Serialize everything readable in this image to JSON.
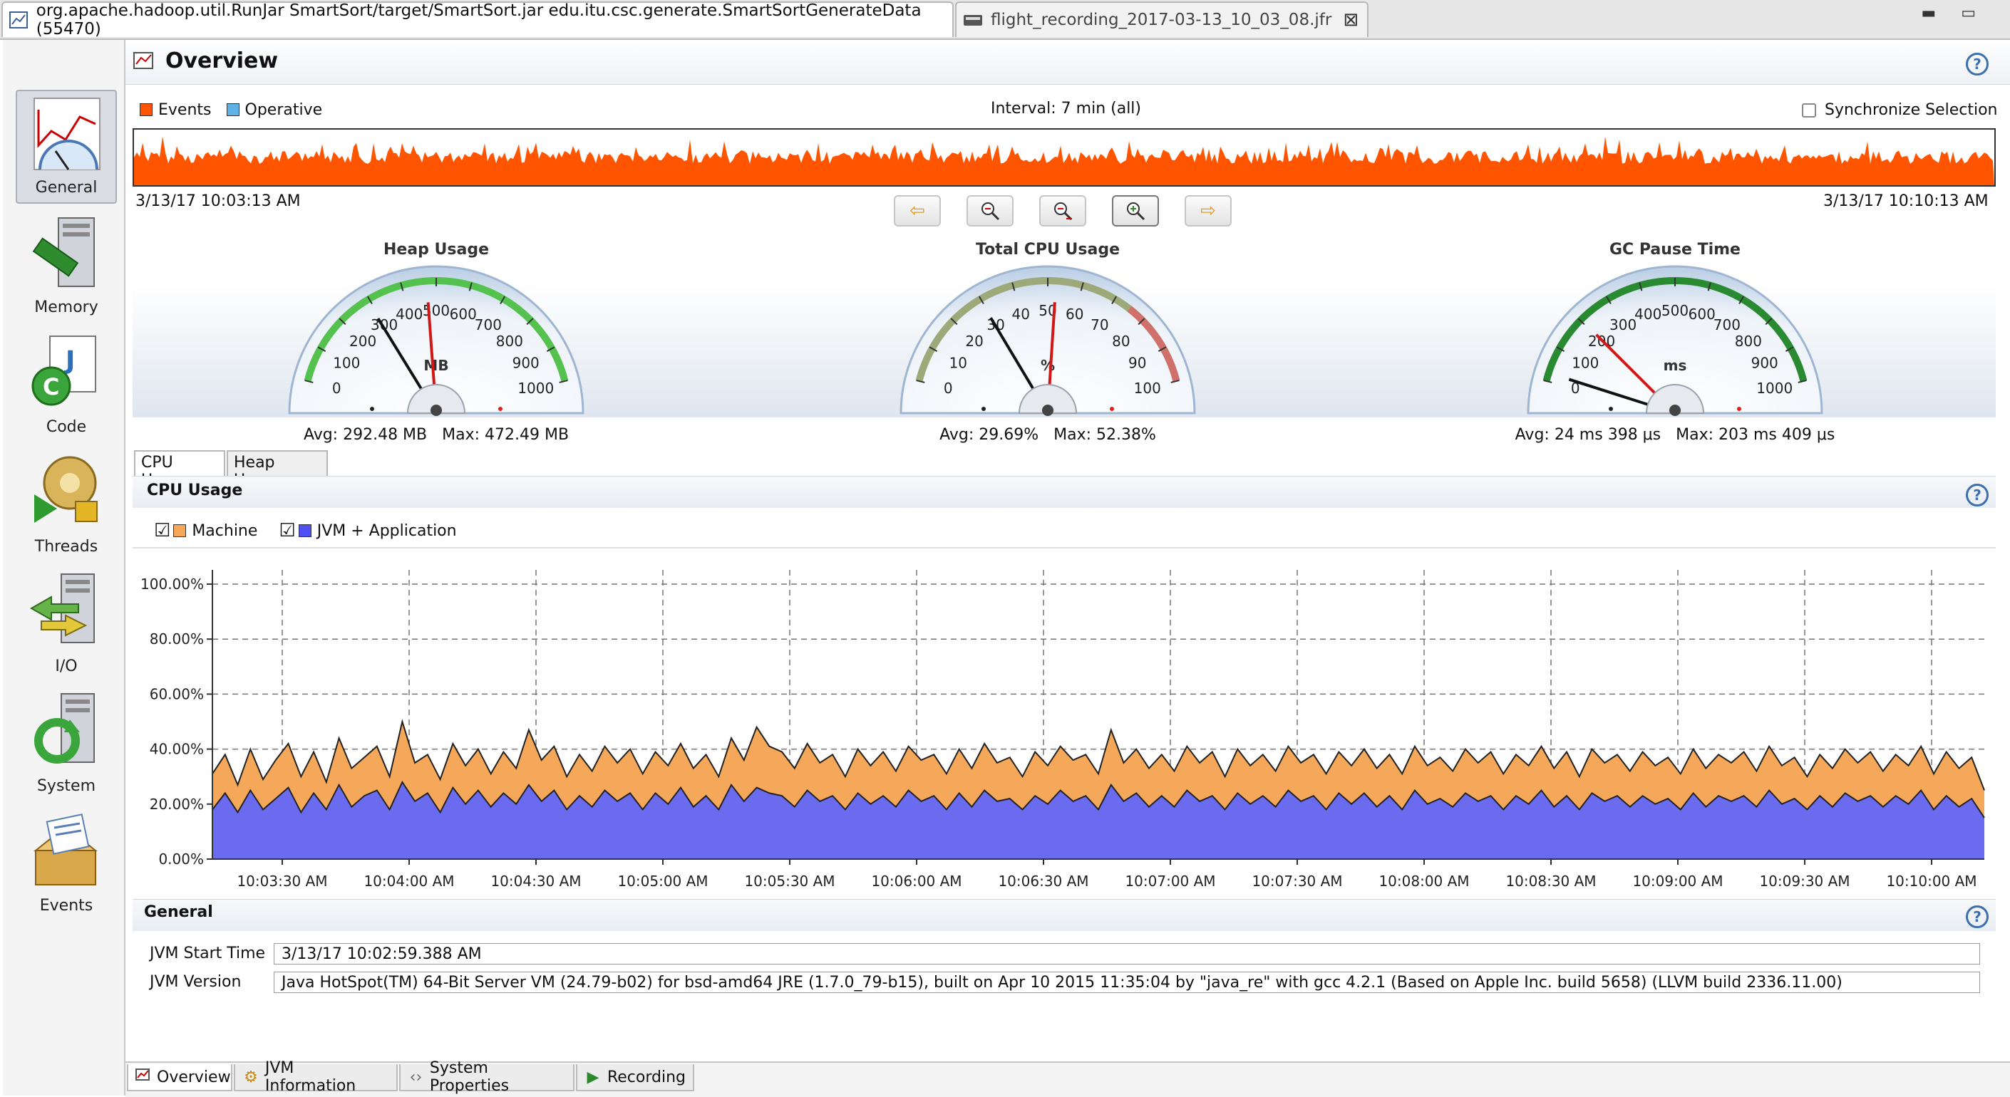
{
  "window": {
    "tabs": [
      {
        "label": "org.apache.hadoop.util.RunJar SmartSort/target/SmartSort.jar edu.itu.csc.generate.SmartSortGenerateData (55470)",
        "icon": "chart-line-icon",
        "active": true
      },
      {
        "label": "flight_recording_2017-03-13_10_03_08.jfr",
        "icon": "recording-icon",
        "active": false
      }
    ]
  },
  "nav": {
    "items": [
      {
        "label": "General",
        "icon": "general-gauge-icon",
        "selected": true
      },
      {
        "label": "Memory",
        "icon": "memory-icon"
      },
      {
        "label": "Code",
        "icon": "code-icon"
      },
      {
        "label": "Threads",
        "icon": "threads-icon"
      },
      {
        "label": "I/O",
        "icon": "io-icon"
      },
      {
        "label": "System",
        "icon": "system-icon"
      },
      {
        "label": "Events",
        "icon": "events-icon"
      }
    ]
  },
  "overview": {
    "title": "Overview",
    "legend": [
      {
        "label": "Events",
        "color": "#ff5500"
      },
      {
        "label": "Operative",
        "color": "#5fb2e6"
      }
    ],
    "interval": "Interval: 7 min (all)",
    "sync_label": "Synchronize Selection",
    "start_time": "3/13/17 10:03:13 AM",
    "end_time": "3/13/17 10:10:13 AM"
  },
  "gauges": [
    {
      "title": "Heap Usage",
      "unit": "MB",
      "ticks": [
        "0",
        "100",
        "200",
        "300",
        "400",
        "500",
        "600",
        "700",
        "800",
        "900",
        "1000"
      ],
      "avg_label": "Avg: 292.48 MB",
      "max_label": "Max: 472.49 MB",
      "value": 292.48,
      "max": 472.49,
      "range_max": 1000
    },
    {
      "title": "Total CPU Usage",
      "unit": "%",
      "ticks": [
        "0",
        "10",
        "20",
        "30",
        "40",
        "50",
        "60",
        "70",
        "80",
        "90",
        "100"
      ],
      "avg_label": "Avg: 29.69%",
      "max_label": "Max: 52.38%",
      "value": 29.69,
      "max": 52.38,
      "range_max": 100
    },
    {
      "title": "GC Pause Time",
      "unit": "ms",
      "ticks": [
        "0",
        "100",
        "200",
        "300",
        "400",
        "500",
        "600",
        "700",
        "800",
        "900",
        "1000"
      ],
      "avg_label": "Avg: 24 ms 398 μs",
      "max_label": "Max: 203 ms 409 μs",
      "value": 24.398,
      "max": 203.409,
      "range_max": 1000
    }
  ],
  "subtabs": [
    "CPU Usage",
    "Heap Usage"
  ],
  "cpu_panel": {
    "title": "CPU Usage",
    "series_toggles": [
      {
        "label": "Machine",
        "checked": true,
        "color": "#f5a85a"
      },
      {
        "label": "JVM + Application",
        "checked": true,
        "color": "#6b6bf0"
      }
    ]
  },
  "chart_data": {
    "type": "area",
    "title": "CPU Usage",
    "y_ticks": [
      "0.00%",
      "20.00%",
      "40.00%",
      "60.00%",
      "80.00%",
      "100.00%"
    ],
    "ylim": [
      0,
      100
    ],
    "grid": true,
    "x_ticks": [
      "10:03:30 AM",
      "10:04:00 AM",
      "10:04:30 AM",
      "10:05:00 AM",
      "10:05:30 AM",
      "10:06:00 AM",
      "10:06:30 AM",
      "10:07:00 AM",
      "10:07:30 AM",
      "10:08:00 AM",
      "10:08:30 AM",
      "10:09:00 AM",
      "10:09:30 AM",
      "10:10:00 AM"
    ],
    "series": [
      {
        "name": "Machine",
        "color": "#f5a85a",
        "values": [
          31,
          38,
          27,
          40,
          29,
          36,
          42,
          30,
          39,
          28,
          44,
          33,
          37,
          41,
          30,
          50,
          35,
          38,
          29,
          42,
          34,
          40,
          31,
          39,
          33,
          47,
          36,
          41,
          30,
          38,
          32,
          41,
          35,
          40,
          31,
          39,
          34,
          42,
          33,
          38,
          30,
          44,
          36,
          48,
          41,
          39,
          33,
          42,
          35,
          38,
          30,
          40,
          34,
          39,
          32,
          41,
          36,
          38,
          31,
          40,
          33,
          42,
          35,
          37,
          30,
          39,
          34,
          41,
          36,
          38,
          31,
          47,
          35,
          40,
          33,
          38,
          32,
          41,
          35,
          39,
          30,
          40,
          34,
          38,
          32,
          41,
          35,
          38,
          31,
          39,
          34,
          40,
          33,
          38,
          31,
          41,
          34,
          37,
          32,
          40,
          35,
          39,
          31,
          38,
          34,
          41,
          33,
          39,
          30,
          40,
          35,
          38,
          32,
          39,
          34,
          37,
          31,
          40,
          33,
          38,
          35,
          39,
          32,
          41,
          34,
          37,
          30,
          38,
          33,
          40,
          35,
          39,
          32,
          38,
          34,
          41,
          31,
          39,
          33,
          37,
          25
        ]
      },
      {
        "name": "JVM + Application",
        "color": "#6b6bf0",
        "values": [
          18,
          24,
          17,
          25,
          18,
          22,
          26,
          17,
          24,
          18,
          27,
          19,
          23,
          25,
          18,
          28,
          21,
          24,
          17,
          26,
          20,
          25,
          19,
          24,
          20,
          27,
          21,
          25,
          18,
          23,
          19,
          25,
          21,
          24,
          18,
          24,
          20,
          26,
          19,
          23,
          18,
          27,
          21,
          26,
          24,
          23,
          19,
          25,
          21,
          23,
          18,
          24,
          20,
          23,
          19,
          25,
          21,
          23,
          18,
          24,
          19,
          25,
          21,
          22,
          18,
          23,
          20,
          25,
          21,
          23,
          18,
          27,
          21,
          24,
          19,
          23,
          19,
          25,
          21,
          23,
          18,
          24,
          20,
          23,
          19,
          25,
          21,
          23,
          18,
          24,
          20,
          24,
          19,
          23,
          18,
          25,
          20,
          22,
          19,
          24,
          21,
          23,
          18,
          23,
          20,
          25,
          19,
          23,
          18,
          24,
          21,
          23,
          19,
          23,
          20,
          22,
          18,
          24,
          19,
          23,
          21,
          23,
          19,
          25,
          20,
          22,
          18,
          23,
          19,
          24,
          21,
          23,
          19,
          23,
          20,
          25,
          18,
          23,
          19,
          22,
          15
        ]
      }
    ]
  },
  "general_panel": {
    "title": "General",
    "rows": [
      {
        "label": "JVM Start Time",
        "value": "3/13/17 10:02:59.388 AM"
      },
      {
        "label": "JVM Version",
        "value": "Java HotSpot(TM) 64-Bit Server VM (24.79-b02) for bsd-amd64 JRE (1.7.0_79-b15), built on Apr 10 2015 11:35:04 by \"java_re\" with gcc 4.2.1 (Based on Apple Inc. build 5658) (LLVM build 2336.11.00)"
      }
    ]
  },
  "bottom_tabs": [
    {
      "label": "Overview",
      "icon": "overview-icon",
      "selected": true
    },
    {
      "label": "JVM Information",
      "icon": "gears-icon"
    },
    {
      "label": "System Properties",
      "icon": "properties-icon"
    },
    {
      "label": "Recording",
      "icon": "play-icon"
    }
  ]
}
